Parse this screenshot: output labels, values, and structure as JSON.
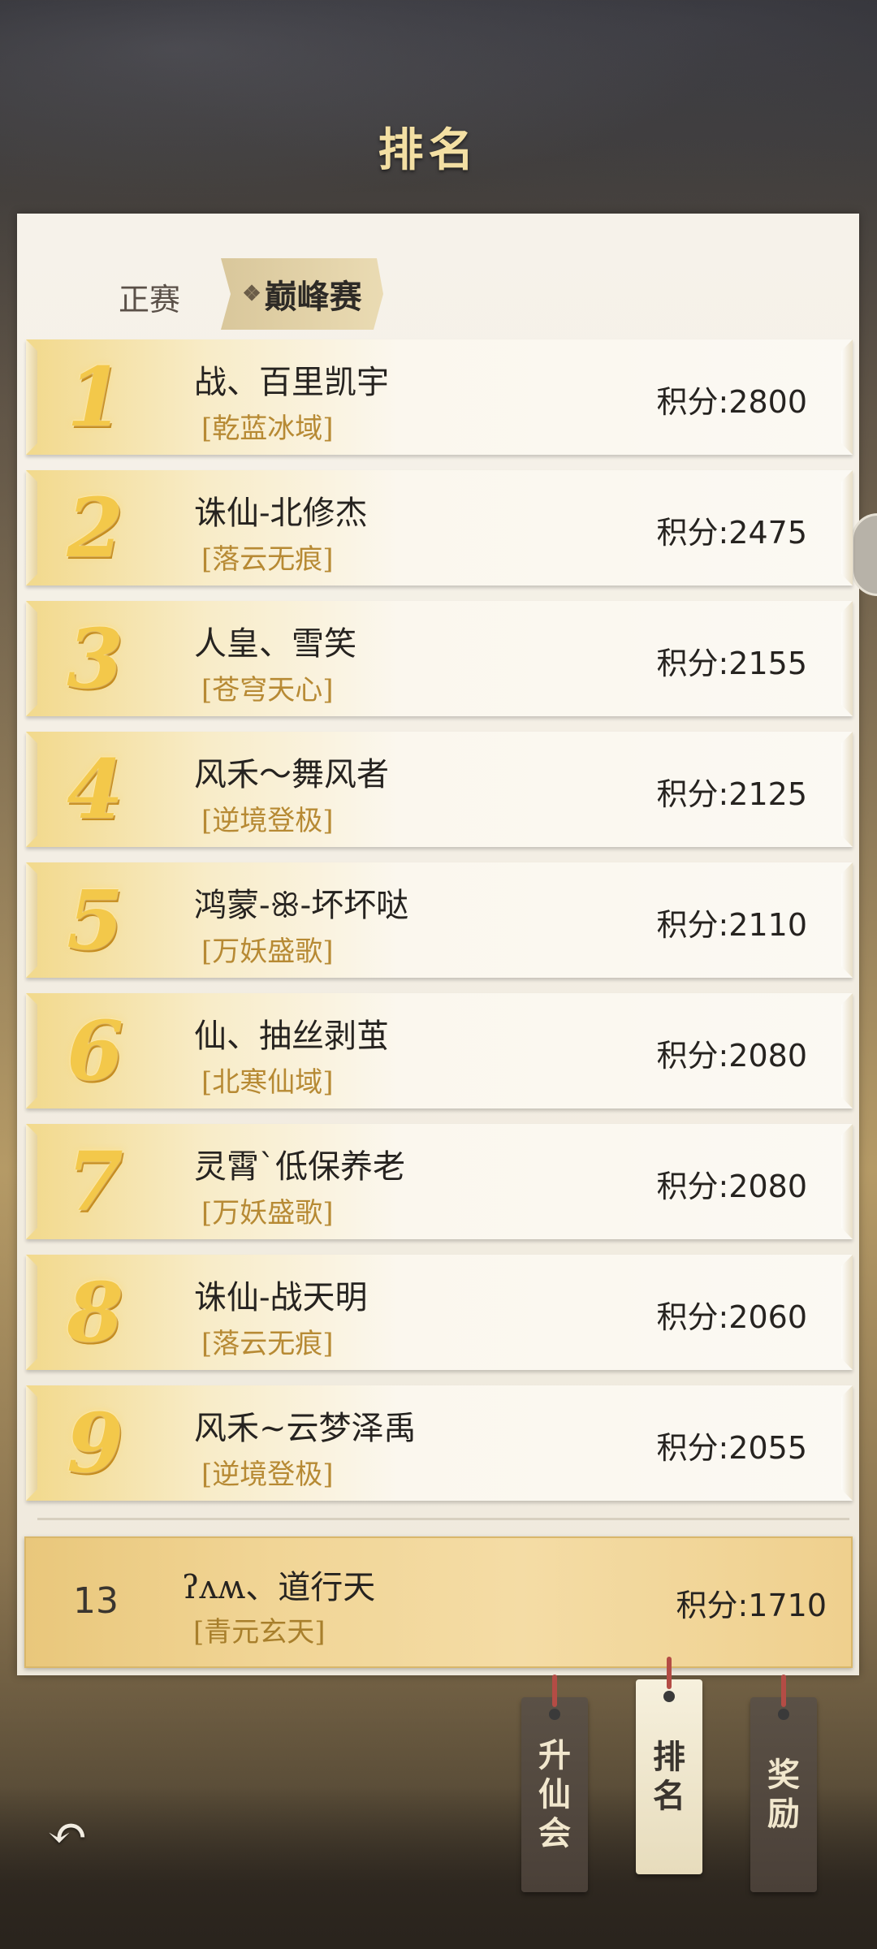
{
  "header": {
    "title": "排名"
  },
  "tabs": [
    {
      "label": "正赛",
      "active": false
    },
    {
      "label": "巅峰赛",
      "active": true
    }
  ],
  "tab_icon": "diamond-icon",
  "rankings": [
    {
      "rank": "1",
      "name": "战、百里凯宇",
      "realm": "[乾蓝冰域]",
      "score": "积分:2800"
    },
    {
      "rank": "2",
      "name": "诛仙-北修杰",
      "realm": "[落云无痕]",
      "score": "积分:2475"
    },
    {
      "rank": "3",
      "name": "人皇、雪笑",
      "realm": "[苍穹天心]",
      "score": "积分:2155"
    },
    {
      "rank": "4",
      "name": "风禾～舞风者",
      "realm": "[逆境登极]",
      "score": "积分:2125"
    },
    {
      "rank": "5",
      "name": "鸿蒙-ꕥ-坏坏哒",
      "realm": "[万妖盛歌]",
      "score": "积分:2110"
    },
    {
      "rank": "6",
      "name": "仙、抽丝剥茧",
      "realm": "[北寒仙域]",
      "score": "积分:2080"
    },
    {
      "rank": "7",
      "name": "灵霄`低保养老",
      "realm": "[万妖盛歌]",
      "score": "积分:2080"
    },
    {
      "rank": "8",
      "name": "诛仙-战天明",
      "realm": "[落云无痕]",
      "score": "积分:2060"
    },
    {
      "rank": "9",
      "name": "风禾~云梦泽禹",
      "realm": "[逆境登极]",
      "score": "积分:2055"
    }
  ],
  "my_entry": {
    "rank": "13",
    "name": "ʔᴧʍ、道行天",
    "realm": "[青元玄天]",
    "score": "积分:1710"
  },
  "bottom_nav": [
    {
      "label": "升仙会",
      "chars": [
        "升",
        "仙",
        "会"
      ]
    },
    {
      "label": "排名",
      "chars": [
        "排",
        "名"
      ]
    },
    {
      "label": "奖励",
      "chars": [
        "奖",
        "励"
      ]
    }
  ],
  "icons": {
    "back": "back-arrow-icon",
    "side": "side-handle-icon"
  }
}
